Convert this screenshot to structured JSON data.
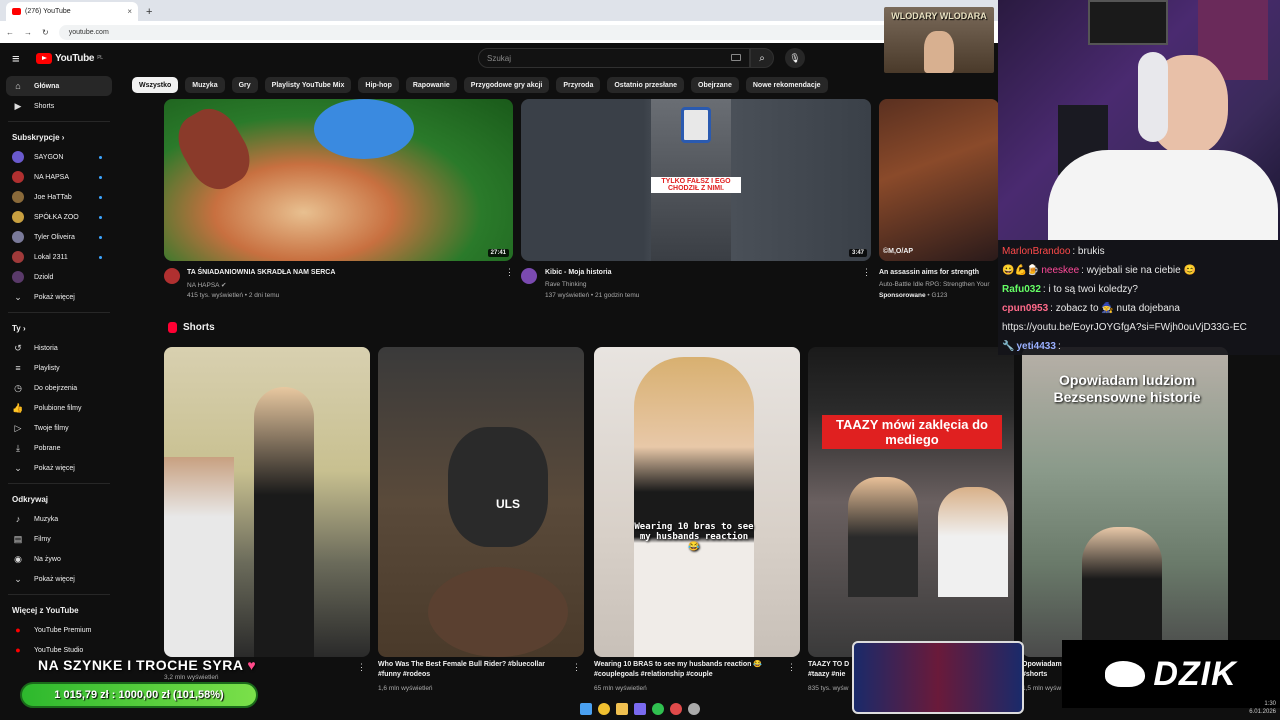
{
  "browser": {
    "tab_title": "(276) YouTube",
    "tab_close": "×",
    "new_tab": "+",
    "url": "youtube.com"
  },
  "masthead": {
    "logo_text": "YouTube",
    "logo_region": "PL",
    "search_placeholder": "Szukaj"
  },
  "chips": [
    "Wszystko",
    "Muzyka",
    "Gry",
    "Playlisty YouTube Mix",
    "Hip-hop",
    "Rapowanie",
    "Przygodowe gry akcji",
    "Przyroda",
    "Ostatnio przesłane",
    "Obejrzane",
    "Nowe rekomendacje"
  ],
  "sidebar": {
    "main": [
      {
        "label": "Główna",
        "icon": "home-icon",
        "glyph": "⌂"
      },
      {
        "label": "Shorts",
        "icon": "shorts-icon",
        "glyph": "▶"
      }
    ],
    "subs_header": "Subskrypcje  ›",
    "subs": [
      {
        "label": "SAYGON",
        "color": "#6a5acd"
      },
      {
        "label": "NA HAPSA",
        "color": "#b03030"
      },
      {
        "label": "Joe HaTTab",
        "color": "#8a6a3a"
      },
      {
        "label": "SPÓŁKA ZOO",
        "color": "#c8a040"
      },
      {
        "label": "Tyler Oliveira",
        "color": "#7a7a9a"
      },
      {
        "label": "Lokal 2311",
        "color": "#a03a3a"
      },
      {
        "label": "Dziold",
        "color": "#5a3a6a"
      }
    ],
    "subs_more": "Pokaż więcej",
    "you_header": "Ty  ›",
    "you": [
      {
        "label": "Historia",
        "glyph": "↺",
        "icon": "history-icon"
      },
      {
        "label": "Playlisty",
        "glyph": "≡",
        "icon": "playlist-icon"
      },
      {
        "label": "Do obejrzenia",
        "glyph": "◷",
        "icon": "watch-later-icon"
      },
      {
        "label": "Polubione filmy",
        "glyph": "👍",
        "icon": "like-icon"
      },
      {
        "label": "Twoje filmy",
        "glyph": "▷",
        "icon": "your-videos-icon"
      },
      {
        "label": "Pobrane",
        "glyph": "⤓",
        "icon": "download-icon"
      },
      {
        "label": "Pokaż więcej",
        "glyph": "⌄",
        "icon": "chevron-down-icon"
      }
    ],
    "explore_header": "Odkrywaj",
    "explore": [
      {
        "label": "Muzyka",
        "glyph": "♪",
        "icon": "music-icon"
      },
      {
        "label": "Filmy",
        "glyph": "▤",
        "icon": "movies-icon"
      },
      {
        "label": "Na żywo",
        "glyph": "◉",
        "icon": "live-icon"
      },
      {
        "label": "Pokaż więcej",
        "glyph": "⌄",
        "icon": "chevron-down-icon"
      }
    ],
    "more_header": "Więcej z YouTube",
    "more": [
      {
        "label": "YouTube Premium"
      },
      {
        "label": "YouTube Studio"
      }
    ]
  },
  "videos": [
    {
      "title": "TA ŚNIADANIOWNIA SKRADŁA NAM SERCA",
      "channel": "NA HAPSA",
      "verified": "✔",
      "meta": "415 tys. wyświetleń • 2 dni temu",
      "duration": "27:41"
    },
    {
      "title": "Kibic - Moja historia",
      "channel": "Rave Thinking",
      "meta": "137 wyświetleń • 21 godzin temu",
      "duration": "3:47",
      "overlay": "TYLKO FAŁSZ I EGO CHODZIŁ Z NIMI."
    },
    {
      "title": "An assassin aims for strength",
      "channel": "Auto-Battle Idle RPG: Strengthen Your",
      "sponsored": "Sponsorowane",
      "sponsor_name": "• G123",
      "watermark": "©M,O/AP"
    }
  ],
  "shorts_header": "Shorts",
  "shorts": [
    {
      "title": "",
      "meta": "3,2 mln wyświetleń"
    },
    {
      "title": "Who Was The Best Female Bull Rider? #bluecollar #funny #rodeos",
      "meta": "1,6 mln wyświetleń",
      "overlay": "ULS"
    },
    {
      "title": "Wearing 10 BRAS to see my husbands reaction 😂 #couplegoals #relationship #couple",
      "meta": "65 mln wyświetleń",
      "overlay": "Wearing 10 bras to see my husbands reaction 😂"
    },
    {
      "title": "TAAZY TO D #taazy #nie",
      "meta": "835 tys. wyśw",
      "overlay": "TAAZY mówi zaklęcia do mediego"
    },
    {
      "title": "Opowiadam #shorts",
      "meta": "1,5 mln wyśw",
      "overlay": "Opowiadam ludziom Bezsensowne historie"
    }
  ],
  "chat": [
    {
      "nick": "MarlonBrandoo",
      "text": ": brukis",
      "cls": "nick1"
    },
    {
      "prefix": "😀💪🍺",
      "nick": "neeskee",
      "text": ": wyjebali sie na ciebie 😊",
      "cls": "nick2"
    },
    {
      "nick": "Rafu032",
      "text": ": i to są twoi koledzy?",
      "cls": "nick3"
    },
    {
      "nick": "cpun0953",
      "text": ": zobacz to 🧙 nuta dojebana",
      "cls": "nick4"
    },
    {
      "nick": "",
      "text": "https://youtu.be/EoyrJOYGfgA?si=FWjh0ouVjD33G-EC",
      "cls": ""
    },
    {
      "prefix": "🔧",
      "nick": "yeti4433",
      "text": ":",
      "cls": "nick5"
    }
  ],
  "banner": "WLODARY WLODARA",
  "stream_overlay": {
    "title": "NA SZYNKE I TROCHE SYRA",
    "title_emoji": "♥",
    "goal": "1 015,79 zł  :  1000,00 zł  (101,58%)",
    "brand": "DZIK"
  },
  "clock": {
    "time": "1:30",
    "date": "6.01.2026"
  },
  "colors": {
    "accent": "#ff0000",
    "background": "#0f0f0f",
    "chip": "#272727",
    "goal": "#2db82d"
  }
}
